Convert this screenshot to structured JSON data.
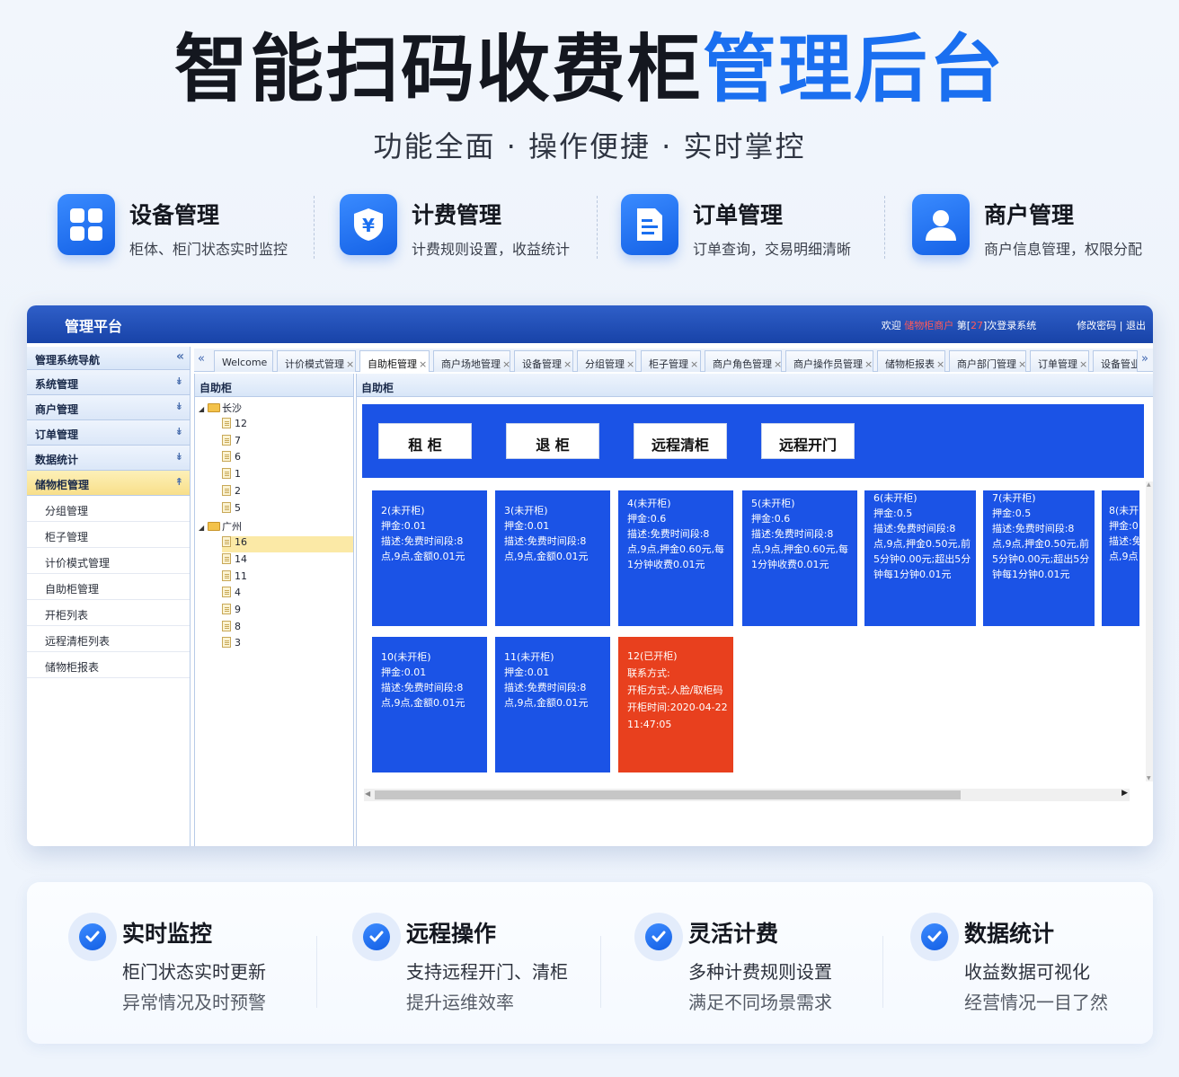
{
  "hero": {
    "title_dark": "智能扫码收费柜",
    "title_blue": "管理后台",
    "subtitle": "功能全面 · 操作便捷 · 实时掌控"
  },
  "features": [
    {
      "icon": "grid-icon",
      "title": "设备管理",
      "desc": "柜体、柜门状态实时监控"
    },
    {
      "icon": "yuan-shield-icon",
      "title": "计费管理",
      "desc": "计费规则设置，收益统计"
    },
    {
      "icon": "order-document-icon",
      "title": "订单管理",
      "desc": "订单查询，交易明细清晰"
    },
    {
      "icon": "user-icon",
      "title": "商户管理",
      "desc": "商户信息管理，权限分配"
    }
  ],
  "admin": {
    "brand": "管理平台",
    "welcome_prefix": "欢迎",
    "welcome_user": "储物柜商户",
    "welcome_mid": "第[",
    "welcome_count": "27",
    "welcome_suffix": "]次登录系统",
    "account_links": "修改密码 | 退出",
    "nav": {
      "header": "管理系统导航",
      "collapse_icon": "«",
      "sections": [
        {
          "label": "系统管理",
          "active": false
        },
        {
          "label": "商户管理",
          "active": false
        },
        {
          "label": "订单管理",
          "active": false
        },
        {
          "label": "数据统计",
          "active": false
        },
        {
          "label": "储物柜管理",
          "active": true
        }
      ],
      "subitems": [
        "分组管理",
        "柜子管理",
        "计价模式管理",
        "自助柜管理",
        "开柜列表",
        "远程清柜列表",
        "储物柜报表"
      ]
    },
    "tabs": [
      {
        "label": "Welcome",
        "closable": false,
        "active": false
      },
      {
        "label": "计价模式管理",
        "closable": true,
        "active": false
      },
      {
        "label": "自助柜管理",
        "closable": true,
        "active": true
      },
      {
        "label": "商户场地管理",
        "closable": true,
        "active": false
      },
      {
        "label": "设备管理",
        "closable": true,
        "active": false
      },
      {
        "label": "分组管理",
        "closable": true,
        "active": false
      },
      {
        "label": "柜子管理",
        "closable": true,
        "active": false
      },
      {
        "label": "商户角色管理",
        "closable": true,
        "active": false
      },
      {
        "label": "商户操作员管理",
        "closable": true,
        "active": false
      },
      {
        "label": "储物柜报表",
        "closable": true,
        "active": false
      },
      {
        "label": "商户部门管理",
        "closable": true,
        "active": false
      },
      {
        "label": "订单管理",
        "closable": true,
        "active": false
      },
      {
        "label": "设备管业",
        "closable": false,
        "active": false
      }
    ],
    "tab_close": "×",
    "tab_prev": "«",
    "tab_next": "»",
    "tree": {
      "header": "自助柜",
      "groups": [
        {
          "name": "长沙",
          "items": [
            "12",
            "7",
            "6",
            "1",
            "2",
            "5"
          ]
        },
        {
          "name": "广州",
          "items": [
            "16",
            "14",
            "11",
            "4",
            "9",
            "8",
            "3"
          ]
        }
      ],
      "selected": "16"
    },
    "main": {
      "header": "自助柜",
      "buttons": [
        "租 柜",
        "退 柜",
        "远程清柜",
        "远程开门"
      ],
      "cabinets": [
        {
          "lines": [
            "2(未开柜)",
            "押金:0.01",
            "描述:免费时间段:8",
            "点,9点,金额0.01元"
          ],
          "open": false
        },
        {
          "lines": [
            "3(未开柜)",
            "押金:0.01",
            "描述:免费时间段:8",
            "点,9点,金额0.01元"
          ],
          "open": false
        },
        {
          "lines": [
            "4(未开柜)",
            "押金:0.6",
            "描述:免费时间段:8",
            "点,9点,押金0.60元,每",
            "1分钟收费0.01元"
          ],
          "open": false
        },
        {
          "lines": [
            "5(未开柜)",
            "押金:0.6",
            "描述:免费时间段:8",
            "点,9点,押金0.60元,每",
            "1分钟收费0.01元"
          ],
          "open": false
        },
        {
          "lines": [
            "6(未开柜)",
            "押金:0.5",
            "描述:免费时间段:8",
            "点,9点,押金0.50元,前",
            "5分钟0.00元;超出5分",
            "钟每1分钟0.01元"
          ],
          "open": false
        },
        {
          "lines": [
            "7(未开柜)",
            "押金:0.5",
            "描述:免费时间段:8",
            "点,9点,押金0.50元,前",
            "5分钟0.00元;超出5分",
            "钟每1分钟0.01元"
          ],
          "open": false
        },
        {
          "lines": [
            "8(未开",
            "押金:0",
            "描述:免",
            "点,9点"
          ],
          "open": false
        },
        {
          "lines": [
            "10(未开柜)",
            "押金:0.01",
            "描述:免费时间段:8",
            "点,9点,金额0.01元"
          ],
          "open": false
        },
        {
          "lines": [
            "11(未开柜)",
            "押金:0.01",
            "描述:免费时间段:8",
            "点,9点,金额0.01元"
          ],
          "open": false
        },
        {
          "lines": [
            "12(已开柜)",
            "联系方式:",
            "开柜方式:人脸/取柜码",
            "开柜时间:2020-04-22",
            "11:47:05"
          ],
          "open": true
        }
      ]
    }
  },
  "benefits": [
    {
      "title": "实时监控",
      "line1": "柜门状态实时更新",
      "line2": "异常情况及时预警"
    },
    {
      "title": "远程操作",
      "line1": "支持远程开门、清柜",
      "line2": "提升运维效率"
    },
    {
      "title": "灵活计费",
      "line1": "多种计费规则设置",
      "line2": "满足不同场景需求"
    },
    {
      "title": "数据统计",
      "line1": "收益数据可视化",
      "line2": "经营情况一目了然"
    }
  ],
  "colors": {
    "accent_blue": "#1a6ff0",
    "cabinet_closed": "#1b53e6",
    "cabinet_open": "#e8401e",
    "topbar": "#1843a8"
  }
}
